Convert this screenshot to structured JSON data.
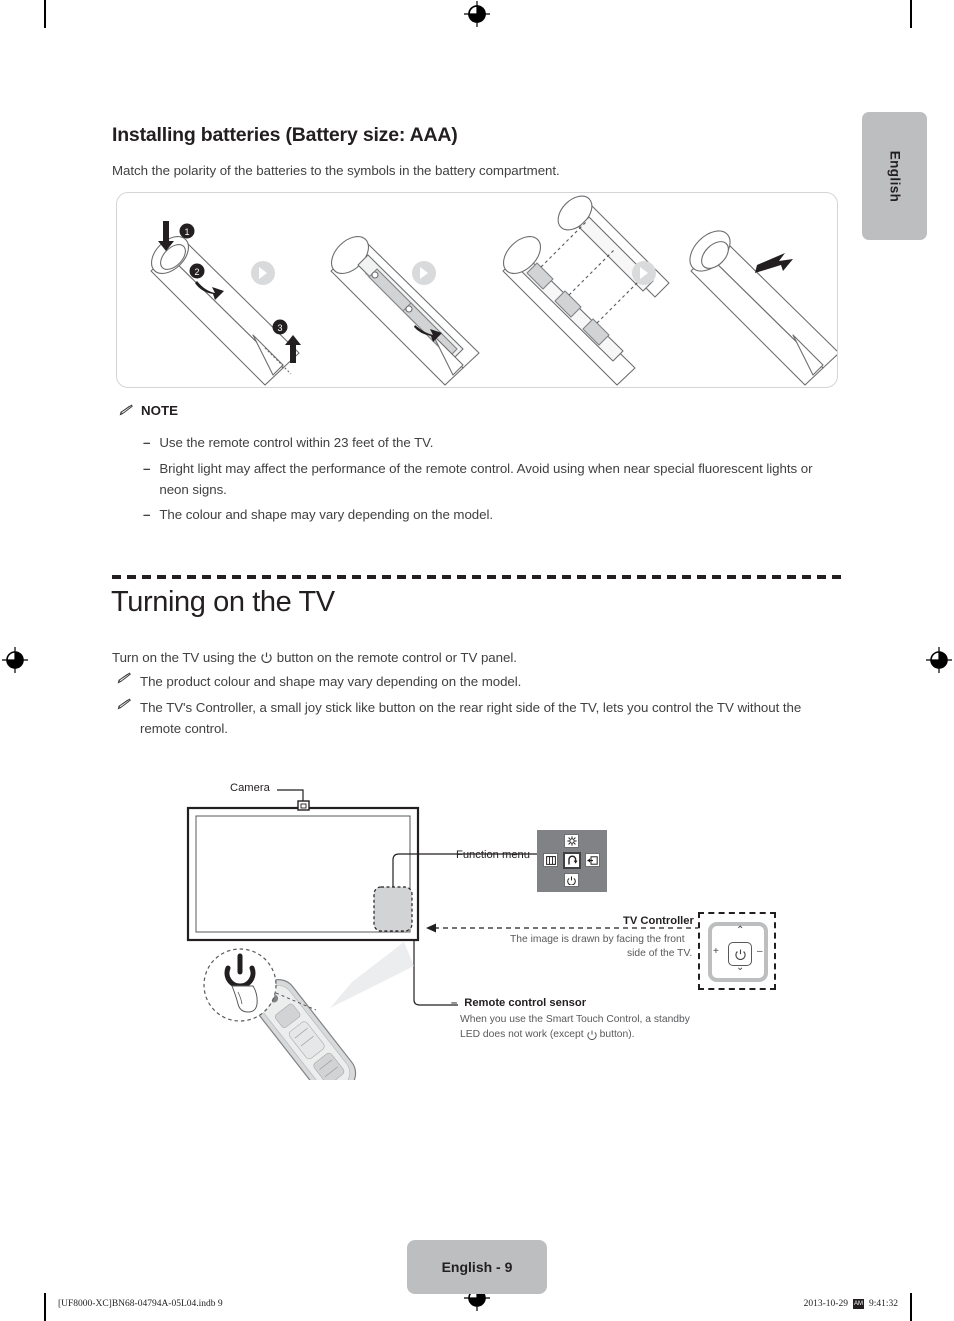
{
  "document": {
    "language_tab": "English",
    "page_footer_label": "English - 9",
    "footer_file": "[UF8000-XC]BN68-04794A-05L04.indb   9",
    "footer_date": "2013-10-29",
    "footer_time": "9:41:32",
    "footer_glyph": "AM"
  },
  "section_batteries": {
    "heading": "Installing batteries (Battery size: AAA)",
    "intro": "Match the polarity of the batteries to the symbols in the battery compartment.",
    "illustration": {
      "alt": "Four step remote control battery installation diagram",
      "step_markers": [
        "1",
        "2",
        "3"
      ],
      "separator_icon": "arrow-right-circle-icon"
    },
    "note": {
      "icon": "note-pencil-icon",
      "title": "NOTE",
      "bullet_marker": "–",
      "items": [
        "Use the remote control within 23 feet of the TV.",
        "Bright light may affect the performance of the remote control. Avoid using when near special fluorescent lights or neon signs.",
        "The colour and shape may vary depending on the model."
      ]
    }
  },
  "section_turning_on": {
    "heading": "Turning on the TV",
    "body_before_icon": "Turn on the TV using the",
    "body_icon": "power-icon",
    "body_after_icon": "button on the remote control or TV panel.",
    "notes": [
      {
        "icon": "note-pencil-icon",
        "text": "The product colour and shape may vary depending on the model."
      },
      {
        "icon": "note-pencil-icon",
        "text": "The TV's Controller, a small joy stick like button on the rear right side of the TV, lets you control the TV without the remote control."
      }
    ],
    "diagram": {
      "camera_label": "Camera",
      "function_menu_label": "Function menu",
      "function_menu_keys": [
        {
          "name": "settings-icon",
          "position": "top"
        },
        {
          "name": "menu-icon",
          "position": "left"
        },
        {
          "name": "return-icon",
          "position": "center"
        },
        {
          "name": "source-icon",
          "position": "right"
        },
        {
          "name": "power-icon",
          "position": "bottom"
        }
      ],
      "tv_controller_label": "TV Controller",
      "tv_controller_note_line1": "The image is drawn by facing the front",
      "tv_controller_note_line2": "side of the TV.",
      "tv_controller_keys": {
        "up": "⌃",
        "down": "⌄",
        "left": "+",
        "right": "–",
        "center": "power-icon"
      },
      "sensor_marker": "–",
      "sensor_label": "Remote control sensor",
      "sensor_text_line1": "When you use the Smart Touch Control, a standby",
      "sensor_text_before_icon": "LED does not work (except",
      "sensor_text_icon": "power-icon",
      "sensor_text_after_icon": "button)."
    }
  },
  "colors": {
    "text_dark": "#231f20",
    "text_body": "#414042",
    "gray_badge": "#bcbec0",
    "gray_panel": "#808285",
    "line_light": "#d4d4d6"
  }
}
